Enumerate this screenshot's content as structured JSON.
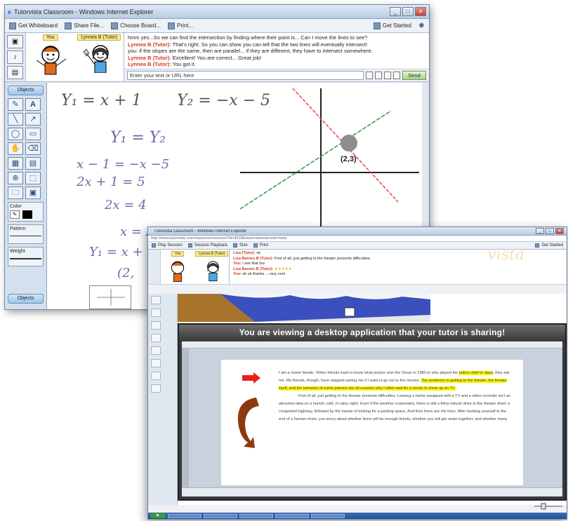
{
  "back_window": {
    "title": "Tutorvista Classroom - Windows Internet Explorer",
    "toolbar": [
      {
        "label": "Get Whiteboard"
      },
      {
        "label": "Share File..."
      },
      {
        "label": "Choose Board..."
      },
      {
        "label": "Print..."
      }
    ],
    "toolbar_right": "Get Started",
    "participants": [
      {
        "name": "You"
      },
      {
        "name": "Lynnea B (Tutor)"
      }
    ],
    "chat": [
      {
        "who": "",
        "text": "hmm yes...So we can find the intersection by finding where their point is... Can I move the lines to see?"
      },
      {
        "who": "Lynnea B (Tutor):",
        "text": "That's right. So you can show you can tell that the two lines will eventually intersect!"
      },
      {
        "who": "",
        "text": "you: if the slopes are the same, then are parallel... if they are different, they have to intersect somewhere."
      },
      {
        "who": "Lynnea B (Tutor):",
        "text": "Excellent! You are correct... Great job!"
      },
      {
        "who": "Lynnea B (Tutor):",
        "text": "You got it."
      }
    ],
    "chat_input_placeholder": "Enter your text or URL here",
    "send_label": "Send",
    "palette_top_label": "Objects",
    "palette_bottom_label": "Objects",
    "color_label": "Color",
    "pattern_label": "Pattern",
    "weight_label": "Weight",
    "handwriting": {
      "eq1": "Y₁ = x + 1",
      "eq2": "Y₂ = −x − 5",
      "l3": "Y₁  =  Y₂",
      "l4": "x − 1   =  −x −5",
      "l5": "2x + 1  =  5",
      "l6": "2x  =  4",
      "l7": "x  =  2",
      "l8": "Y₁ = x +",
      "l9": "(2,",
      "point_label": "(2,3)"
    }
  },
  "front_window": {
    "title": "Tutorvista Classroom - Windows Internet Explorer",
    "address": "http://www.tutorvista.com/classroom/session?id=4418&view=share&mode=tutor",
    "toolbar": [
      "Play Session",
      "Session Playback",
      "Size",
      "Print"
    ],
    "toolbar_right": "Get Started",
    "participants": [
      {
        "name": "You"
      },
      {
        "name": "Lynnea B (Tutor)"
      }
    ],
    "chat": [
      {
        "who": "Lisa (Tutor):",
        "text": "ok"
      },
      {
        "who": "Lisa Barnes B (Tutor):",
        "text": "First of all, just getting to the theater presents difficulties."
      },
      {
        "who": "You:",
        "text": "i see that too"
      },
      {
        "who": "Lisa Barnes B (Tutor):",
        "text": "5 stars"
      },
      {
        "who": "You:",
        "text": "ok ok thanks ... very cool"
      }
    ],
    "rating": "★★★★★",
    "brand_text": "vista",
    "share_banner": "You are viewing a desktop application that your tutor is sharing!",
    "doc_paragraph_1_a": "I am a movie fanatic. When friends want to know what picture won the Oscar in 1980 or who played the ",
    "doc_highlight_1": "police chief in Jaws",
    "doc_paragraph_1_b": ", they ask me. My friends, though, have stopped asking me if I want to go out to the movies. ",
    "doc_highlight_2": "The problems in getting to the theater, the theater itself, and the behavior of some patrons are all reasons why I often wait for a movie to show up on TV.",
    "doc_paragraph_2": "First of all, just getting to the theater presents difficulties. Leaving a home equipped with a TV and a video recorder isn't an attractive idea on a humid, cold, or rainy night. Even if the weather cooperates, there is still a thirty-minute drive to the theater down a congested highway, followed by the hassle of looking for a parking space. And then there are the lines. After hooking yourself to the end of a human chain, you worry about whether there will be enough tickets, whether you will get seats together, and whether many"
  }
}
